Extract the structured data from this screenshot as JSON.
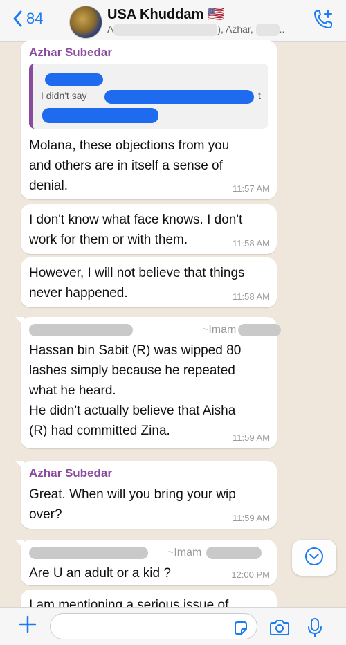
{
  "header": {
    "back_count": "84",
    "group_name": "USA Khuddam 🇺🇸",
    "members_prefix": "A",
    "members_mid": "), Azhar,",
    "members_suffix": ".."
  },
  "messages": [
    {
      "sender": "Azhar Subedar",
      "quote_text": "I didn't say",
      "quote_end": "t",
      "text": "Molana, these objections from you\nand others are in itself a sense of\ndenial.",
      "time": "11:57 AM"
    },
    {
      "text": "I don't know what face knows. I don't\nwork for them or with them.",
      "time": "11:58 AM"
    },
    {
      "text": "However, I will not believe that things\nnever happened.",
      "time": "11:58 AM"
    },
    {
      "name_suffix": "~Imam",
      "text": "Hassan bin Sabit (R) was wipped 80\nlashes simply because he repeated\nwhat he heard.\nHe didn't actually believe that Aisha\n(R) had committed Zina.",
      "time": "11:59 AM"
    },
    {
      "sender": "Azhar Subedar",
      "text": "Great. When will you bring your wip\nover?",
      "time": "11:59 AM"
    },
    {
      "name_suffix": "~Imam",
      "text": "Are U an adult or a kid ?",
      "time": "12:00 PM"
    },
    {
      "text": "I am mentioning a serious issue of"
    }
  ],
  "icons": {
    "back": "chevron-left-icon",
    "add_call": "phone-plus-icon",
    "scroll_down": "chevron-down-circle-icon",
    "attach": "plus-icon",
    "sticker": "sticker-icon",
    "camera": "camera-icon",
    "mic": "microphone-icon"
  },
  "colors": {
    "accent": "#1a7bf2",
    "sender_name": "#8a4b9e",
    "chat_background": "#efe7dc",
    "bubble": "#ffffff"
  }
}
